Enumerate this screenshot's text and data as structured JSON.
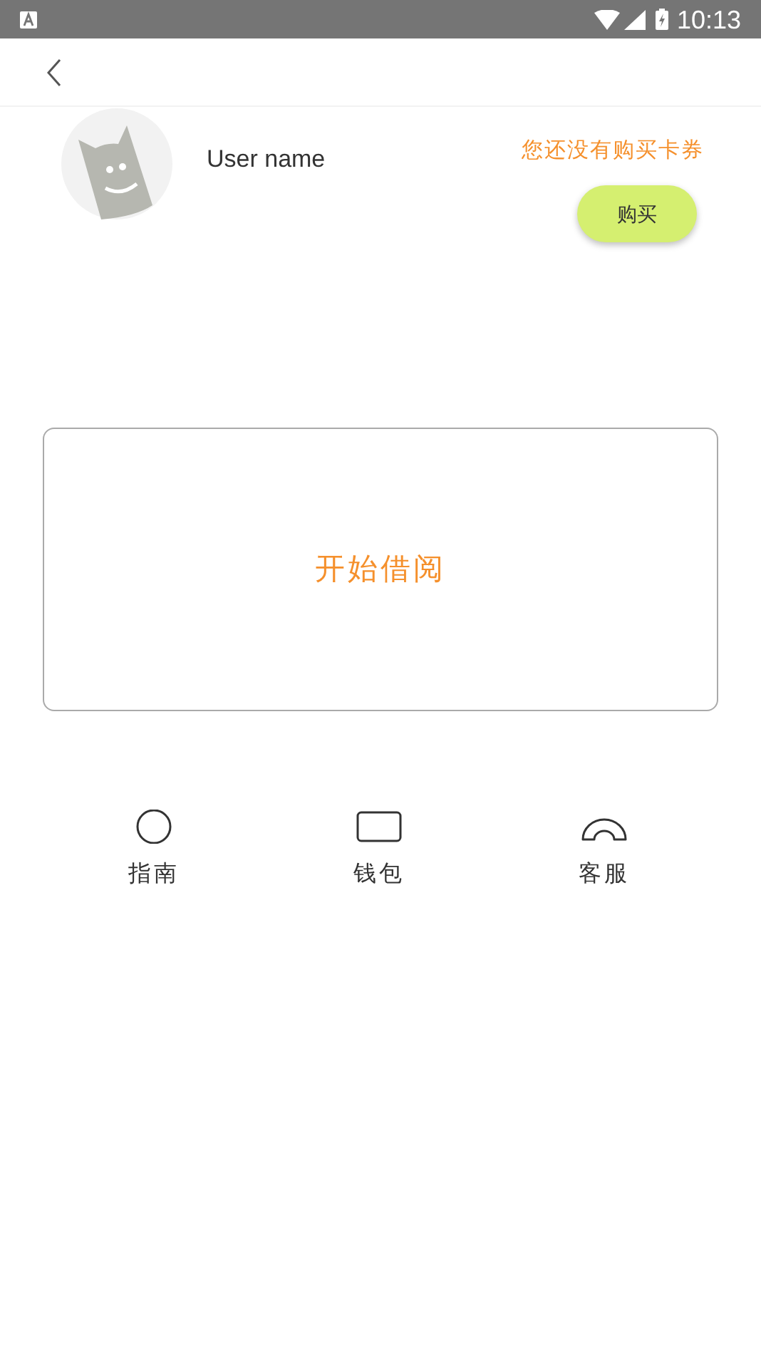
{
  "status_bar": {
    "time": "10:13"
  },
  "profile": {
    "user_name": "User name",
    "card_notice": "您还没有购买卡券",
    "buy_button": "购买"
  },
  "borrow_card": {
    "label": "开始借阅"
  },
  "shortcuts": [
    {
      "kind": "circle",
      "label": "指南"
    },
    {
      "kind": "wallet",
      "label": "钱包"
    },
    {
      "kind": "arch",
      "label": "客服"
    }
  ]
}
